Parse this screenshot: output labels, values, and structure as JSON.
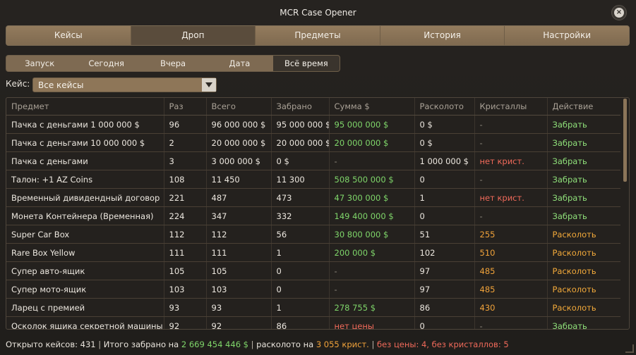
{
  "app": {
    "title": "MCR Case Opener"
  },
  "main_tabs": [
    {
      "label": "Кейсы"
    },
    {
      "label": "Дроп"
    },
    {
      "label": "Предметы"
    },
    {
      "label": "История"
    },
    {
      "label": "Настройки"
    }
  ],
  "main_tabs_active": 1,
  "sub_tabs": [
    {
      "label": "Запуск"
    },
    {
      "label": "Сегодня"
    },
    {
      "label": "Вчера"
    },
    {
      "label": "Дата"
    },
    {
      "label": "Всё время"
    }
  ],
  "sub_tabs_active": 4,
  "case_filter": {
    "label": "Кейс:",
    "value": "Все кейсы"
  },
  "table": {
    "headers": [
      "Предмет",
      "Раз",
      "Всего",
      "Забрано",
      "Сумма $",
      "Расколото",
      "Кристаллы",
      "Действие"
    ],
    "rows": [
      [
        "Пачка с деньгами 1 000 000 $",
        "96",
        "96 000 000 $",
        "95 000 000 $",
        "95 000 000 $",
        "0 $",
        "-",
        "Забрать"
      ],
      [
        "Пачка с деньгами 10 000 000 $",
        "2",
        "20 000 000 $",
        "20 000 000 $",
        "20 000 000 $",
        "0 $",
        "-",
        "Забрать"
      ],
      [
        "Пачка с деньгами",
        "3",
        "3 000 000 $",
        "0 $",
        "-",
        "1 000 000 $",
        "нет крист.",
        "Забрать"
      ],
      [
        "Талон: +1 AZ Coins",
        "108",
        "11 450",
        "11 300",
        "508 500 000 $",
        "0",
        "-",
        "Забрать"
      ],
      [
        "Временный дивидендный договор",
        "221",
        "487",
        "473",
        "47 300 000 $",
        "1",
        "нет крист.",
        "Забрать"
      ],
      [
        "Монета Контейнера (Временная)",
        "224",
        "347",
        "332",
        "149 400 000 $",
        "0",
        "-",
        "Забрать"
      ],
      [
        "Super Car Box",
        "112",
        "112",
        "56",
        "30 800 000 $",
        "51",
        "255",
        "Расколоть"
      ],
      [
        "Rare Box Yellow",
        "111",
        "111",
        "1",
        "200 000 $",
        "102",
        "510",
        "Расколоть"
      ],
      [
        "Супер авто-ящик",
        "105",
        "105",
        "0",
        "-",
        "97",
        "485",
        "Расколоть"
      ],
      [
        "Супер мото-ящик",
        "103",
        "103",
        "0",
        "-",
        "97",
        "485",
        "Расколоть"
      ],
      [
        "Ларец с премией",
        "93",
        "93",
        "1",
        "278 755 $",
        "86",
        "430",
        "Расколоть"
      ],
      [
        "Осколок ящика секретной машины",
        "92",
        "92",
        "86",
        "нет цены",
        "0",
        "-",
        "Забрать"
      ]
    ]
  },
  "footer": {
    "opened_label": "Открыто кейсов: 431",
    "sep1": "|",
    "taken_label": "Итого забрано на",
    "taken_value": "2 669 454 446 $",
    "sep2": "|",
    "split_label": "расколото на",
    "split_value": "3 055 крист.",
    "sep3": "|",
    "warning": "без цены: 4, без кристаллов: 5"
  },
  "colors": {
    "green": "#7fd66a",
    "red": "#f06a5a",
    "orange": "#f0a23a",
    "tab_bg": "#8b7457"
  },
  "icons": {
    "close": "close-icon",
    "dropdown": "chevron-down-icon"
  }
}
